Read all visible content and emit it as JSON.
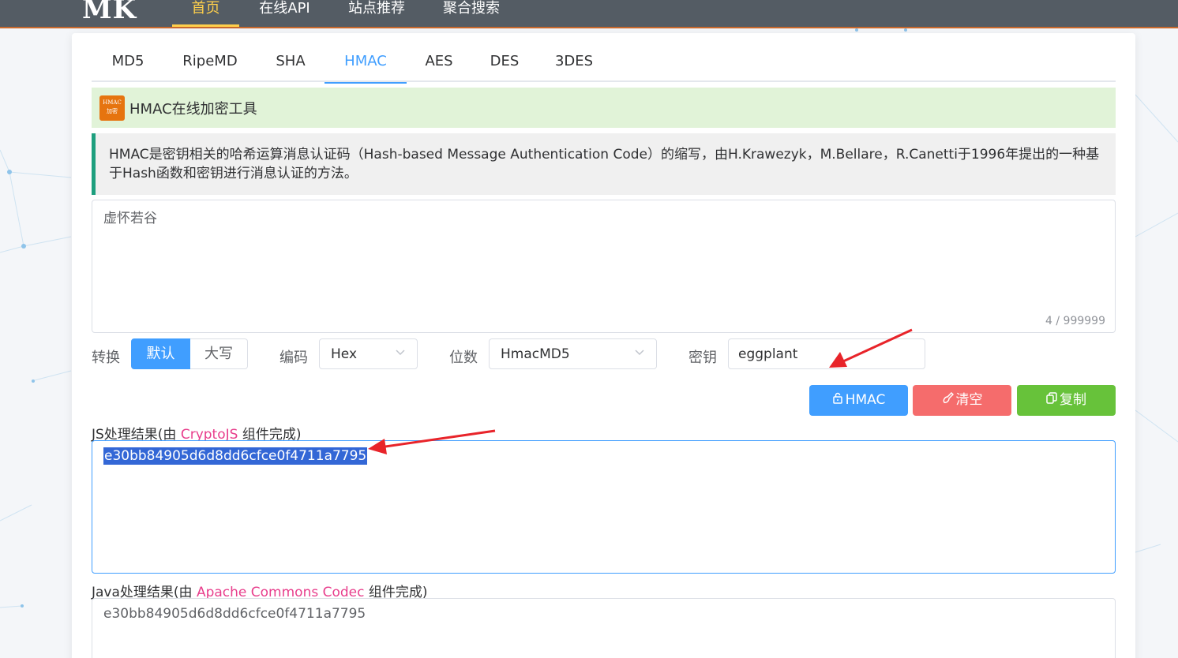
{
  "nav": {
    "logo": "MK",
    "items": [
      {
        "label": "首页",
        "active": true
      },
      {
        "label": "在线API",
        "active": false
      },
      {
        "label": "站点推荐",
        "active": false
      },
      {
        "label": "聚合搜索",
        "active": false
      }
    ]
  },
  "tabs": [
    {
      "label": "MD5",
      "active": false
    },
    {
      "label": "RipeMD",
      "active": false
    },
    {
      "label": "SHA",
      "active": false
    },
    {
      "label": "HMAC",
      "active": true
    },
    {
      "label": "AES",
      "active": false
    },
    {
      "label": "DES",
      "active": false
    },
    {
      "label": "3DES",
      "active": false
    }
  ],
  "banner": {
    "icon_text_top": "HMAC",
    "icon_text_bottom": "加密",
    "title": "HMAC在线加密工具"
  },
  "description": "HMAC是密钥相关的哈希运算消息认证码（Hash-based Message Authentication Code）的缩写，由H.Krawezyk，M.Bellare，R.Canetti于1996年提出的一种基于Hash函数和密钥进行消息认证的方法。",
  "input": {
    "value": "虚怀若谷",
    "counter": "4 / 999999"
  },
  "options": {
    "convert_label": "转换",
    "convert_default": "默认",
    "convert_upper": "大写",
    "encoding_label": "编码",
    "encoding_value": "Hex",
    "bits_label": "位数",
    "bits_value": "HmacMD5",
    "key_label": "密钥",
    "key_value": "eggplant"
  },
  "buttons": {
    "hmac": "HMAC",
    "clear": "清空",
    "copy": "复制"
  },
  "colors": {
    "primary": "#409eff",
    "danger": "#f56c6c",
    "success": "#67c23a",
    "highlight": "#e83e8c"
  },
  "results": {
    "js_label_prefix": "JS处理结果(由 ",
    "js_label_lib": "CryptoJS",
    "js_label_suffix": " 组件完成)",
    "js_value": "e30bb84905d6d8dd6cfce0f4711a7795",
    "java_label_prefix": "Java处理结果(由 ",
    "java_label_lib": "Apache Commons Codec",
    "java_label_suffix": " 组件完成)",
    "java_value": "e30bb84905d6d8dd6cfce0f4711a7795"
  }
}
